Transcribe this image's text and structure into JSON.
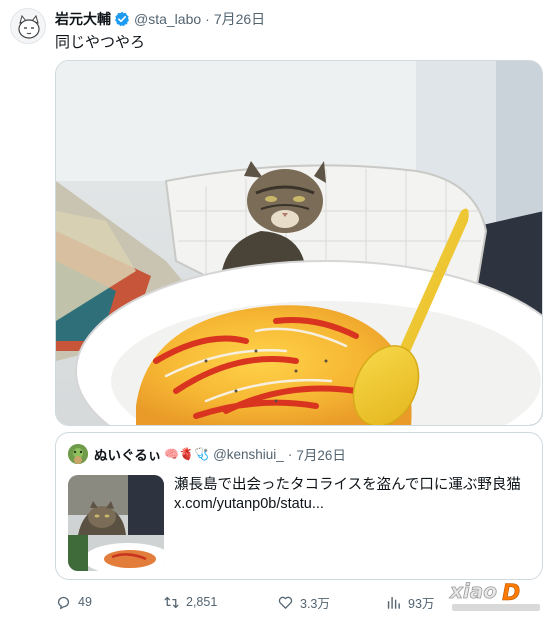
{
  "post": {
    "author_name": "岩元大輔",
    "handle": "@sta_labo",
    "separator": "·",
    "date": "7月26日",
    "text": "同じやつやろ"
  },
  "quote": {
    "author_name": "ぬいぐるぃ",
    "emojis": "🧠🫀🩺",
    "handle": "@kenshiui_",
    "separator": "·",
    "date": "7月26日",
    "text": "瀬長島で出会ったタコライスを盗んで口に運ぶ野良猫",
    "link": "x.com/yutanp0b/statu..."
  },
  "actions": {
    "replies": "49",
    "reposts": "2,851",
    "likes": "3.3万",
    "views": "93万"
  },
  "colors": {
    "verified": "#1d9bf0",
    "muted_text": "#536471",
    "border": "#cfd9de"
  }
}
